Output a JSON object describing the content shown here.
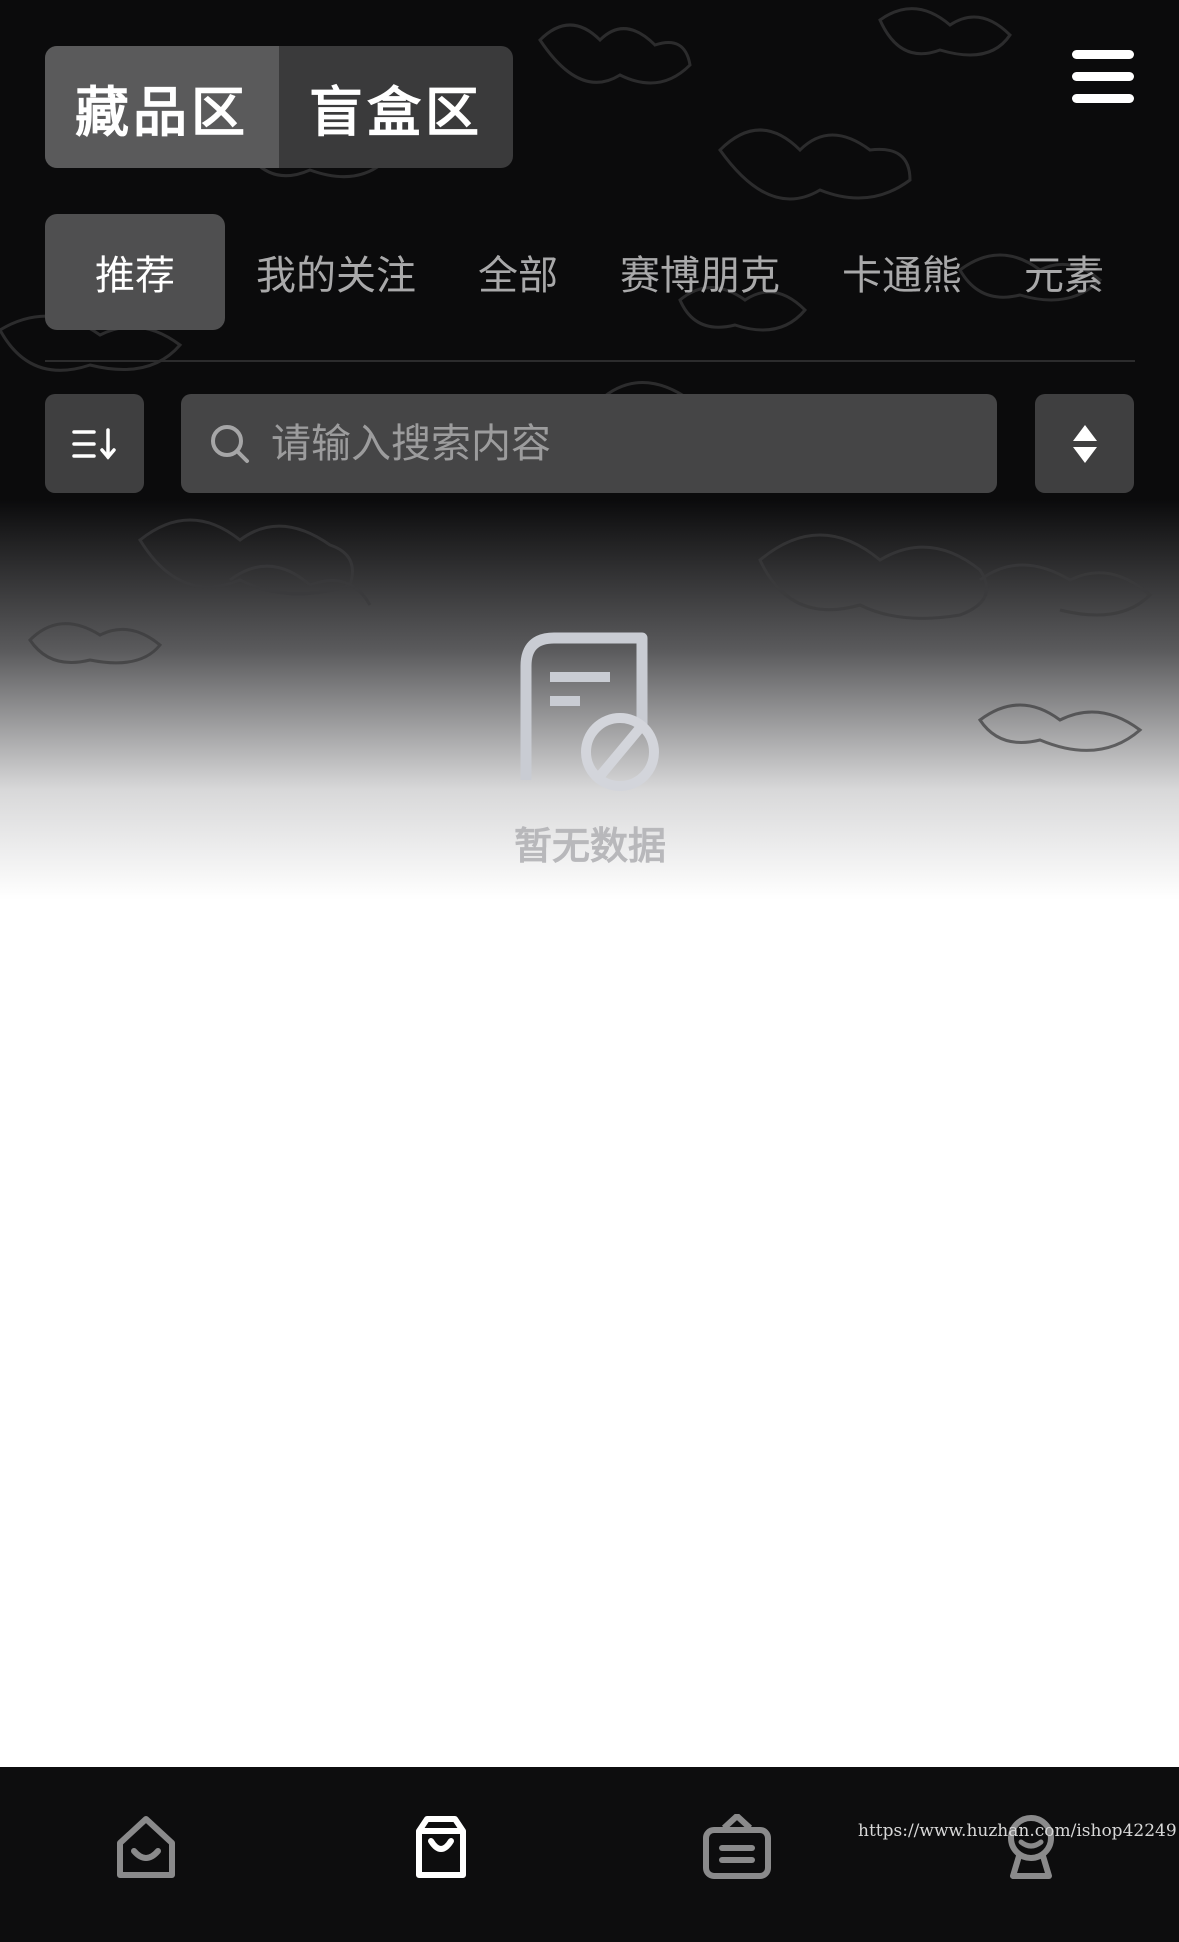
{
  "header": {
    "segments": [
      {
        "label": "藏品区",
        "active": true
      },
      {
        "label": "盲盒区",
        "active": false
      }
    ],
    "menu_icon": "hamburger-menu-icon"
  },
  "categories": [
    {
      "label": "推荐",
      "active": true
    },
    {
      "label": "我的关注",
      "active": false
    },
    {
      "label": "全部",
      "active": false
    },
    {
      "label": "赛博朋克",
      "active": false
    },
    {
      "label": "卡通熊",
      "active": false
    },
    {
      "label": "元素",
      "active": false
    }
  ],
  "toolbar": {
    "filter_icon": "sort-list-icon",
    "search_placeholder": "请输入搜索内容",
    "search_icon": "search-icon",
    "sort_icon": "sort-updown-icon"
  },
  "empty_state": {
    "icon": "no-data-document-icon",
    "text": "暂无数据"
  },
  "tabbar": {
    "items": [
      {
        "icon": "home-icon",
        "active": false
      },
      {
        "icon": "shopping-bag-icon",
        "active": true
      },
      {
        "icon": "market-box-icon",
        "active": false
      },
      {
        "icon": "profile-icon",
        "active": false
      }
    ]
  },
  "watermark": "https://www.huzhan.com/ishop42249",
  "colors": {
    "background_dark": "#0b0b0c",
    "segment_active": "#5a5a5b",
    "category_active": "#4f4f50",
    "search_bg": "#454546",
    "empty_text": "#b8b8bb"
  }
}
